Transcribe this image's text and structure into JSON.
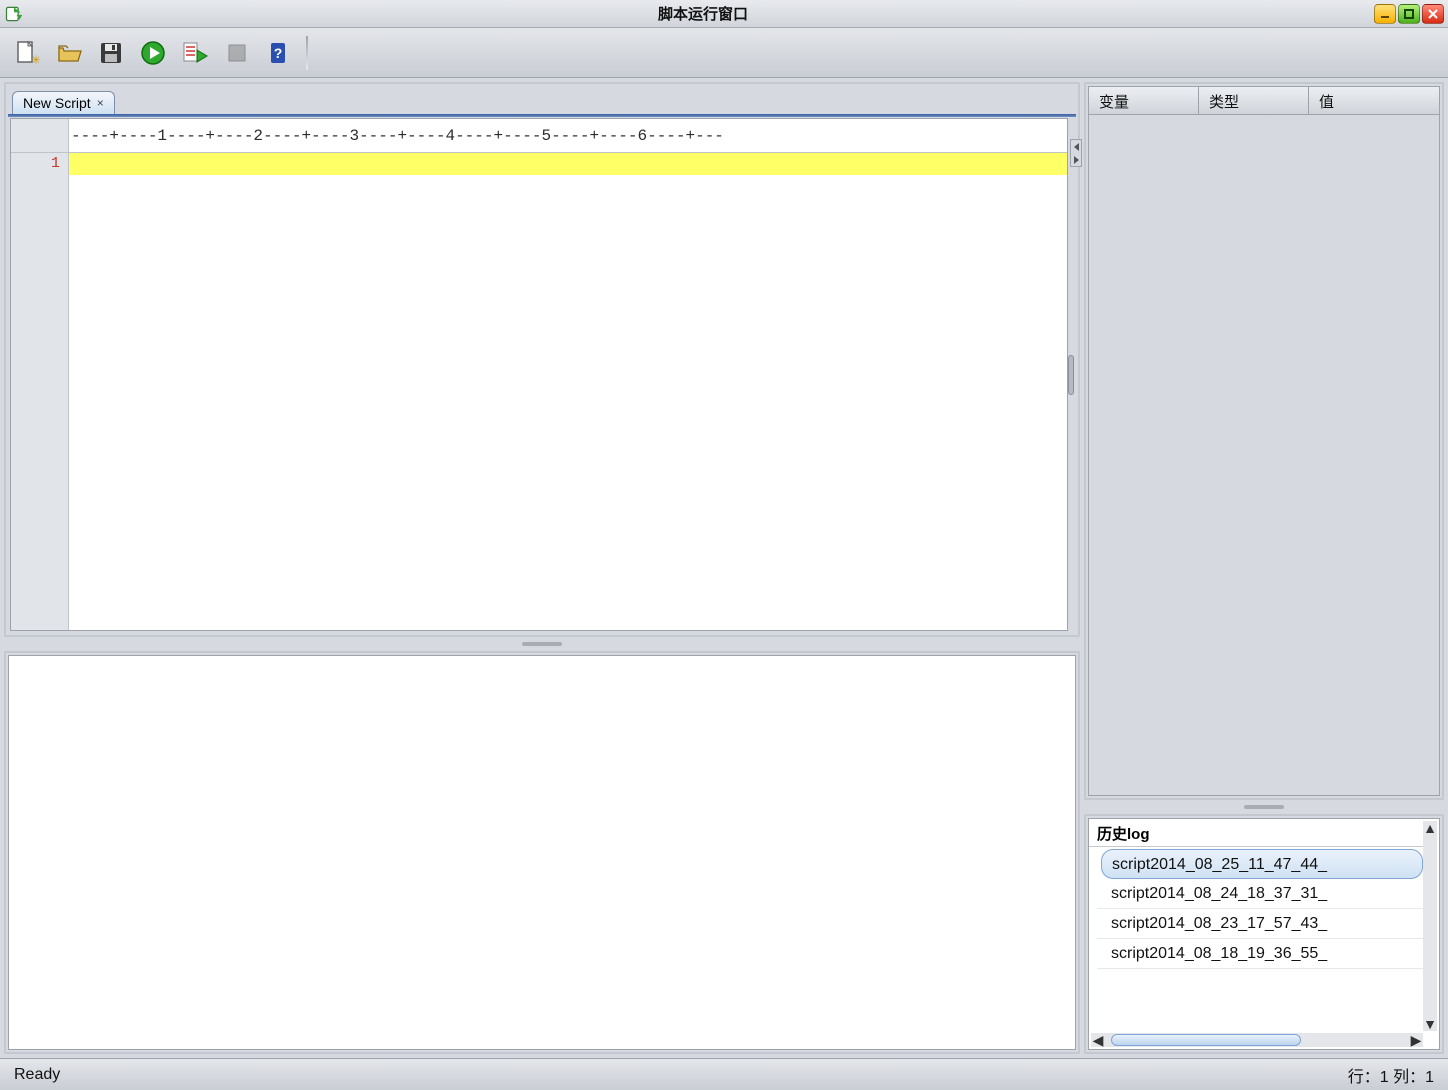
{
  "window": {
    "title": "脚本运行窗口"
  },
  "toolbar": {
    "new": "new",
    "open": "open",
    "save": "save",
    "run": "run",
    "runconfig": "runconfig",
    "stop": "stop",
    "help": "help"
  },
  "tabs": [
    {
      "label": "New Script"
    }
  ],
  "editor": {
    "ruler": "----+----1----+----2----+----3----+----4----+----5----+----6----+---",
    "line_numbers": [
      "1"
    ]
  },
  "variables_panel": {
    "col_variable": "变量",
    "col_type": "类型",
    "col_value": "值",
    "rows": []
  },
  "history_log": {
    "title": "历史log",
    "items": [
      "script2014_08_25_11_47_44_",
      "script2014_08_24_18_37_31_",
      "script2014_08_23_17_57_43_",
      "script2014_08_18_19_36_55_"
    ],
    "selected_index": 0
  },
  "status": {
    "left": "Ready",
    "right": "行：1 列：1"
  }
}
